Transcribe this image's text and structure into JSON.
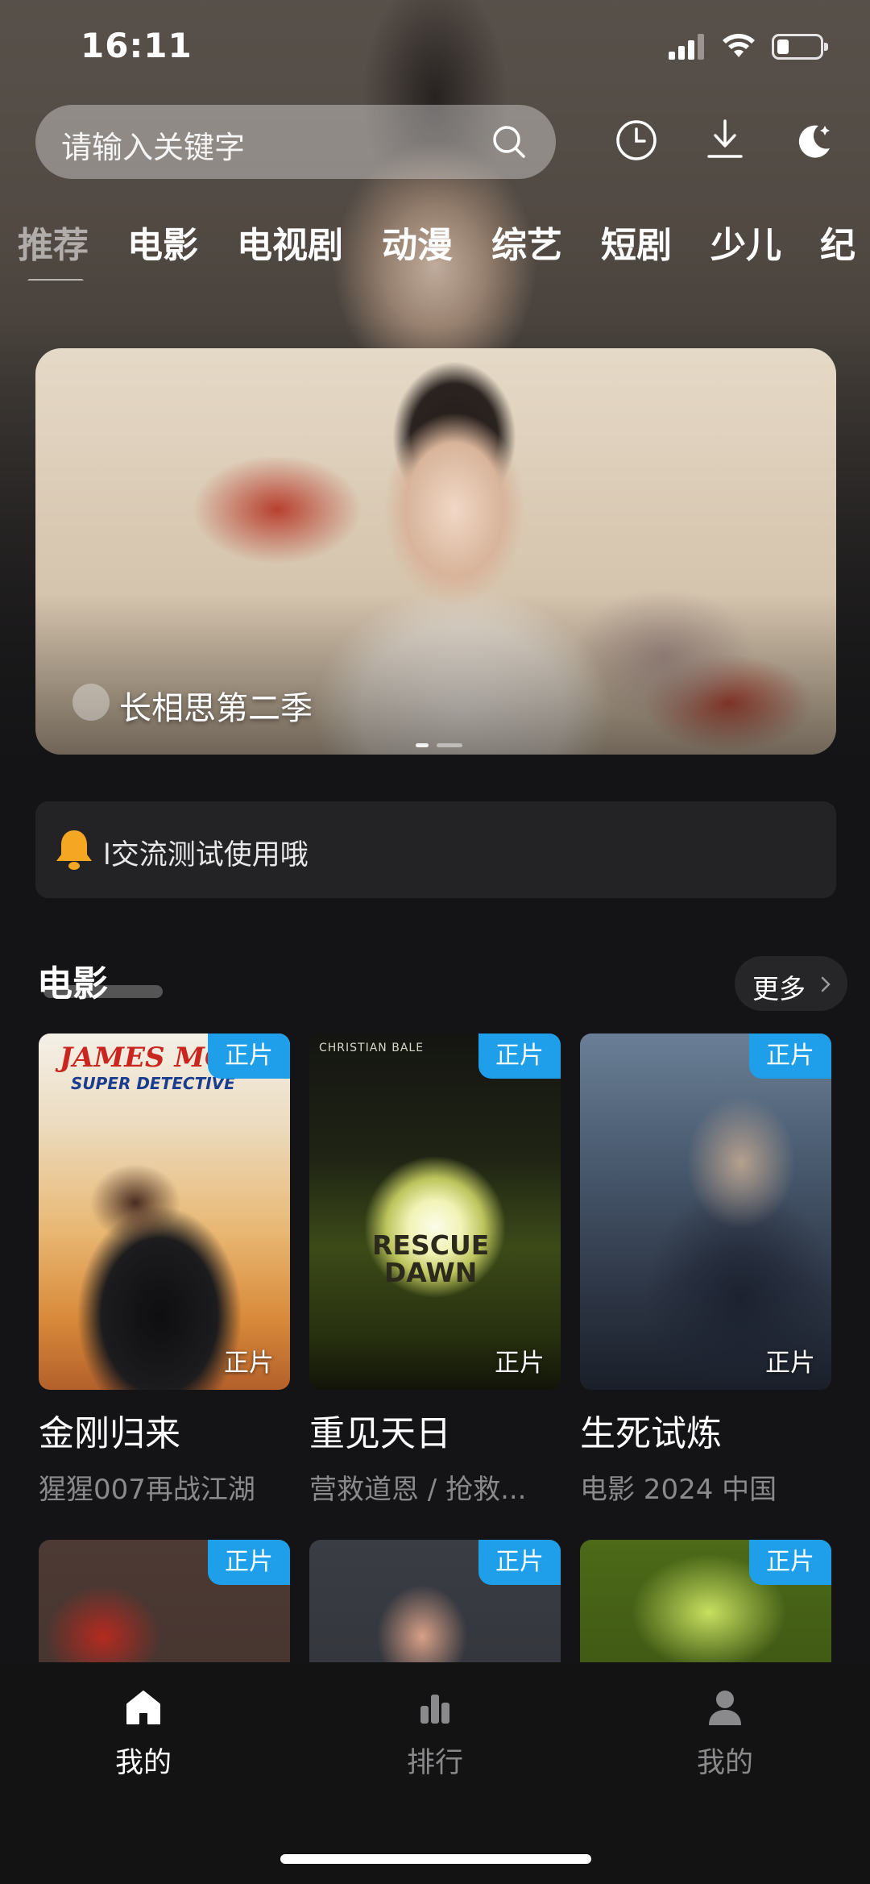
{
  "status_bar": {
    "time": "16:11"
  },
  "search": {
    "placeholder": "请输入关键字"
  },
  "tabs": [
    "推荐",
    "电影",
    "电视剧",
    "动漫",
    "综艺",
    "短剧",
    "少儿",
    "纪"
  ],
  "banner": {
    "title": "长相思第二季",
    "page_count": 2,
    "current_page": 1
  },
  "notice": {
    "text": "l交流测试使用哦"
  },
  "section": {
    "title": "电影",
    "more_label": "更多",
    "movies": [
      {
        "title": "金刚归来",
        "subtitle": "猩猩007再战江湖",
        "badge": "正片",
        "corner_label": "正片",
        "poster_text_1": "JAMES MO",
        "poster_text_2": "SUPER DETECTIVE"
      },
      {
        "title": "重见天日",
        "subtitle": "营救道恩 / 抢救...",
        "badge": "正片",
        "corner_label": "正片",
        "poster_text_1": "CHRISTIAN BALE",
        "poster_text_2": "RESCUE DAWN"
      },
      {
        "title": "生死试炼",
        "subtitle": "电影 2024 中国",
        "badge": "正片",
        "corner_label": "正片"
      }
    ],
    "row2_badges": [
      "正片",
      "正片",
      "正片"
    ]
  },
  "bottom_nav": [
    {
      "label": "我的",
      "icon": "home-icon",
      "active": true
    },
    {
      "label": "排行",
      "icon": "bar-chart-icon",
      "active": false
    },
    {
      "label": "我的",
      "icon": "user-icon",
      "active": false
    }
  ],
  "colors": {
    "accent": "#1f9eea",
    "background": "#141416",
    "bell": "#f5a623"
  }
}
